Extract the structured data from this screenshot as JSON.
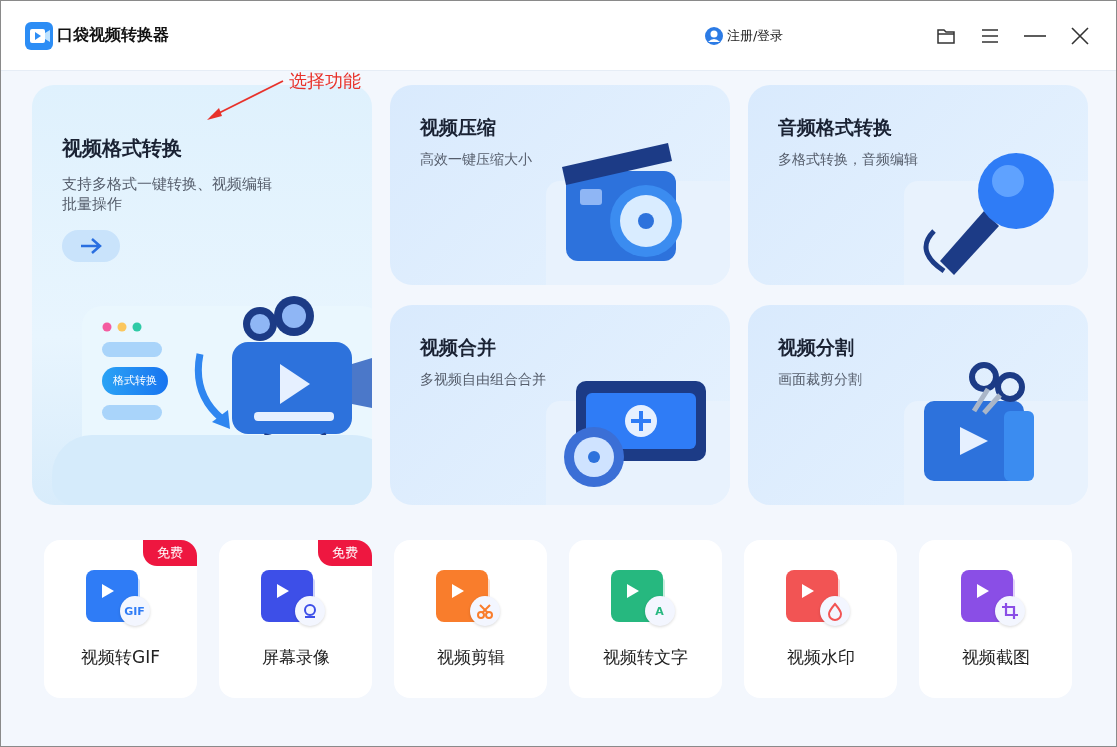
{
  "window": {
    "title": "口袋视频转换器",
    "account_link": "注册/登录"
  },
  "annotation": {
    "text": "选择功能"
  },
  "hero": {
    "title": "视频格式转换",
    "description_lines": [
      "支持多格式一键转换、视频编辑",
      "批量操作"
    ],
    "illustration_label": "格式转换"
  },
  "features": [
    {
      "kind": "compress",
      "title": "视频压缩",
      "subtitle": "高效一键压缩大小"
    },
    {
      "kind": "audio",
      "title": "音频格式转换",
      "subtitle": "多格式转换，音频编辑"
    },
    {
      "kind": "merge",
      "title": "视频合并",
      "subtitle": "多视频自由组合合并"
    },
    {
      "kind": "split",
      "title": "视频分割",
      "subtitle": "画面裁剪分割"
    }
  ],
  "tools": [
    {
      "kind": "gif",
      "label": "视频转GIF",
      "badge": "免费",
      "icon_text": "GIF",
      "color": "#2f7cf6"
    },
    {
      "kind": "record",
      "label": "屏幕录像",
      "badge": "免费",
      "color": "#3d4fe8"
    },
    {
      "kind": "cut",
      "label": "视频剪辑",
      "color": "#f97d2c"
    },
    {
      "kind": "text",
      "label": "视频转文字",
      "icon_text": "A",
      "color": "#26b87f"
    },
    {
      "kind": "watermark",
      "label": "视频水印",
      "color": "#f25454"
    },
    {
      "kind": "crop",
      "label": "视频截图",
      "color": "#8a4ee6"
    }
  ]
}
